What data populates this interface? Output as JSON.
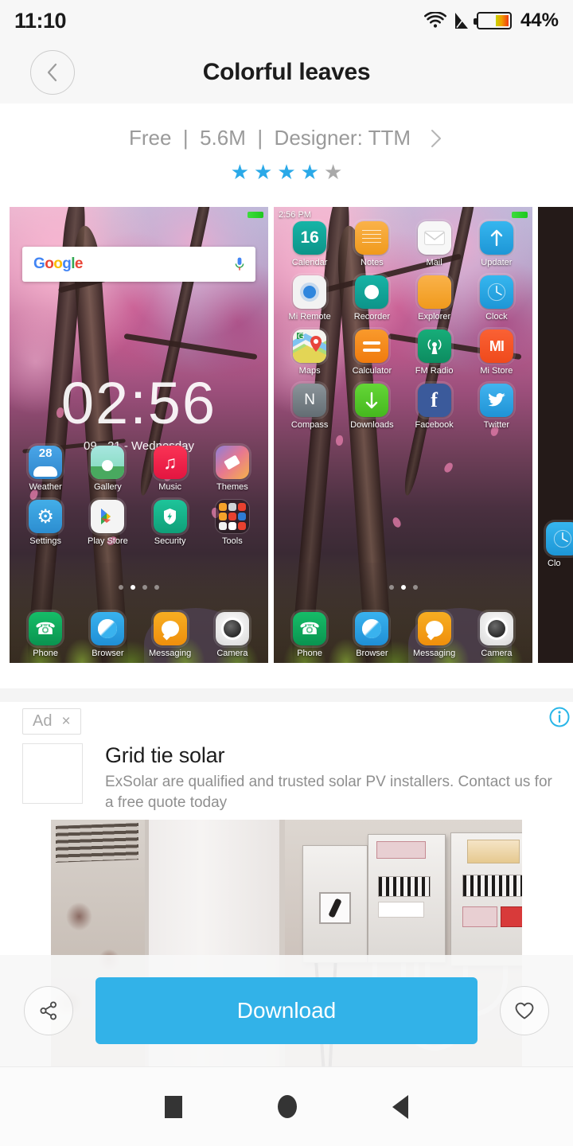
{
  "statusbar": {
    "time": "11:10",
    "battery_percent": "44%",
    "battery_level": 44,
    "icons": [
      "wifi-icon",
      "no-sim-icon",
      "battery-icon"
    ]
  },
  "header": {
    "title": "Colorful leaves",
    "back_icon": "chevron-left-icon"
  },
  "theme_info": {
    "price": "Free",
    "separator": "|",
    "size": "5.6M",
    "designer": "Designer: TTM",
    "full_line": "Free  |  5.6M  |  Designer: TTM",
    "chevron_icon": "chevron-right-icon",
    "rating": 4,
    "rating_max": 5,
    "star_color_on": "#2aa9e8",
    "star_color_off": "#a9a9a9"
  },
  "screenshots": [
    {
      "type": "lockscreen",
      "status_time": "",
      "search_widget": {
        "logo": "Google",
        "mic_icon": "microphone-icon"
      },
      "clock": "02:56",
      "date": "09 - 21 - Wednesday",
      "apps_rows": [
        [
          {
            "label": "Weather",
            "icon": "weather-icon",
            "badge": "28",
            "color": "#3d9ee0"
          },
          {
            "label": "Gallery",
            "icon": "gallery-icon",
            "color": "#7fd6c8"
          },
          {
            "label": "Music",
            "icon": "music-note-icon",
            "color": "#f5294c"
          },
          {
            "label": "Themes",
            "icon": "paint-roller-icon",
            "color": "#e07ab4"
          }
        ],
        [
          {
            "label": "Settings",
            "icon": "gear-icon",
            "color": "#38a8e0"
          },
          {
            "label": "Play Store",
            "icon": "play-store-icon",
            "color": "#f2f2f2"
          },
          {
            "label": "Security",
            "icon": "shield-bolt-icon",
            "color": "#12b287"
          },
          {
            "label": "Tools",
            "icon": "folder-icon",
            "color": "#2a1c22"
          }
        ]
      ],
      "dock": [
        {
          "label": "Phone",
          "icon": "phone-icon",
          "color": "#11a85a"
        },
        {
          "label": "Browser",
          "icon": "compass-browser-icon",
          "color": "#2ba4e8"
        },
        {
          "label": "Messaging",
          "icon": "speech-bubble-icon",
          "color": "#f5a317"
        },
        {
          "label": "Camera",
          "icon": "camera-icon",
          "color": "#f2f2f2"
        }
      ],
      "page_dots": 4,
      "page_dot_active": 1
    },
    {
      "type": "homescreen",
      "status_time": "2:56 PM",
      "apps_rows": [
        [
          {
            "label": "Calendar",
            "icon": "calendar-icon",
            "badge": "16",
            "color": "#12a79a"
          },
          {
            "label": "Notes",
            "icon": "notes-icon",
            "color": "#f5a73a"
          },
          {
            "label": "Mail",
            "icon": "envelope-icon",
            "color": "#f4f4f4"
          },
          {
            "label": "Updater",
            "icon": "arrow-up-icon",
            "color": "#2bb0e8"
          }
        ],
        [
          {
            "label": "Mi Remote",
            "icon": "remote-icon",
            "color": "#f0f0f0"
          },
          {
            "label": "Recorder",
            "icon": "record-circle-icon",
            "color": "#12a79a"
          },
          {
            "label": "Explorer",
            "icon": "folder-explorer-icon",
            "color": "#f5a73a"
          },
          {
            "label": "Clock",
            "icon": "clock-icon",
            "color": "#2bb0e8"
          }
        ],
        [
          {
            "label": "Maps",
            "icon": "maps-pin-icon",
            "color": "#ffffff"
          },
          {
            "label": "Calculator",
            "icon": "equals-icon",
            "color": "#f58a1f"
          },
          {
            "label": "FM Radio",
            "icon": "radio-waves-icon",
            "color": "#12a06f"
          },
          {
            "label": "Mi Store",
            "icon": "mi-logo-icon",
            "color": "#f5552a"
          }
        ],
        [
          {
            "label": "Compass",
            "icon": "compass-north-icon",
            "color": "#6f7b7f"
          },
          {
            "label": "Downloads",
            "icon": "arrow-down-icon",
            "color": "#52c626"
          },
          {
            "label": "Facebook",
            "icon": "facebook-icon",
            "color": "#3c5a9a"
          },
          {
            "label": "Twitter",
            "icon": "twitter-icon",
            "color": "#2ba4e8"
          }
        ]
      ],
      "dock": [
        {
          "label": "Phone",
          "icon": "phone-icon",
          "color": "#11a85a"
        },
        {
          "label": "Browser",
          "icon": "compass-browser-icon",
          "color": "#2ba4e8"
        },
        {
          "label": "Messaging",
          "icon": "speech-bubble-icon",
          "color": "#f5a317"
        },
        {
          "label": "Camera",
          "icon": "camera-icon",
          "color": "#f2f2f2"
        }
      ],
      "page_dots": 3,
      "page_dot_active": 2
    },
    {
      "type": "partial-dark",
      "app_label": "Clo",
      "app_icon": "clock-icon"
    }
  ],
  "ad": {
    "badge_label": "Ad",
    "close_label": "×",
    "info_icon": "info-icon",
    "info_icon_color": "#29b6e8",
    "title": "Grid tie solar",
    "description": "ExSolar are qualified and trusted solar PV installers. Contact us for a free quote today",
    "image_alt": "solar-pv-electrical-panels-photo"
  },
  "actions": {
    "share_icon": "share-icon",
    "download_label": "Download",
    "download_color": "#32b2e8",
    "favorite_icon": "heart-icon"
  },
  "navbar": {
    "recents_icon": "square-recents-icon",
    "home_icon": "circle-home-icon",
    "back_icon": "triangle-back-icon"
  }
}
